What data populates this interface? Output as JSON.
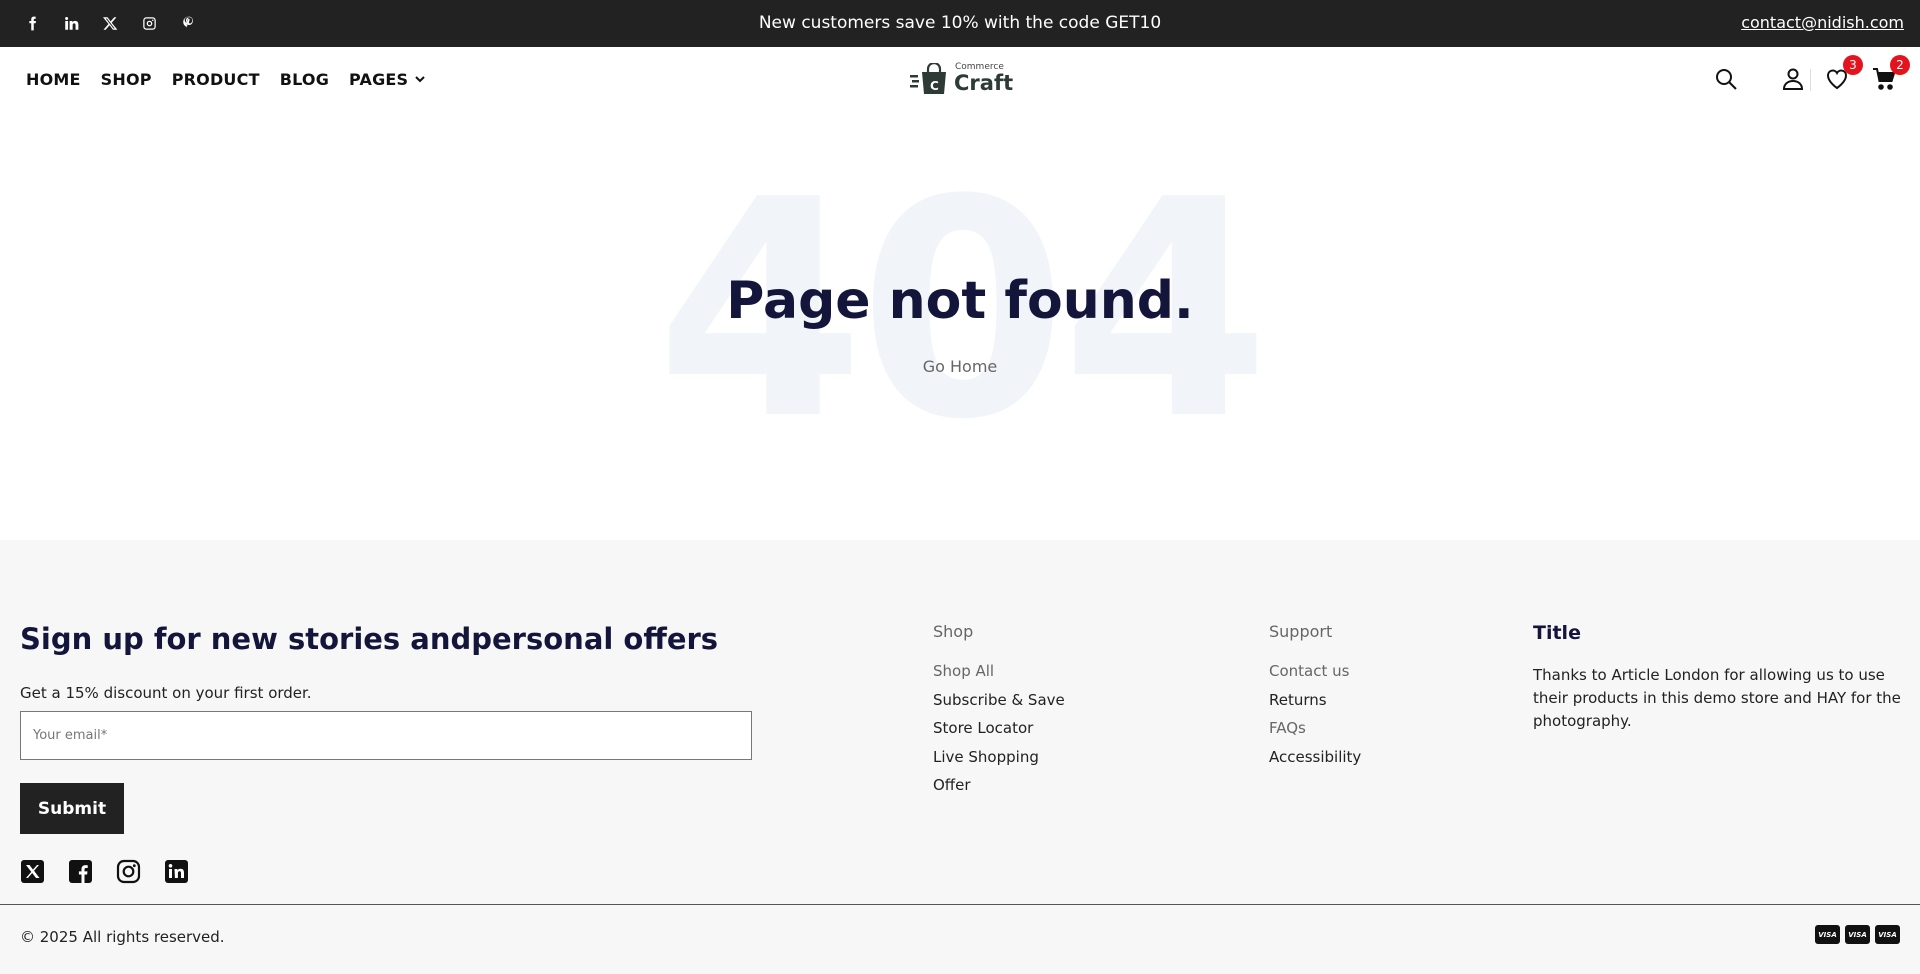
{
  "topbar": {
    "social": [
      {
        "name": "facebook-icon"
      },
      {
        "name": "linkedin-icon"
      },
      {
        "name": "x-icon"
      },
      {
        "name": "instagram-icon"
      },
      {
        "name": "pinterest-icon"
      }
    ],
    "promo": "New customers save 10% with the code GET10",
    "email": "contact@nidish.com"
  },
  "header": {
    "nav": {
      "home": "HOME",
      "shop": "SHOP",
      "product": "PRODUCT",
      "blog": "BLOG",
      "pages": "PAGES"
    },
    "logo": {
      "sub": "Commerce",
      "main": "Craft"
    },
    "wishlist_count": "3",
    "cart_count": "2"
  },
  "main": {
    "bg_text": "404",
    "title": "Page not found.",
    "link": "Go Home"
  },
  "footer": {
    "newsletter": {
      "title": "Sign up for new stories andpersonal offers",
      "desc": "Get a 15% discount on your first order.",
      "placeholder": "Your email*",
      "submit": "Submit"
    },
    "shop": {
      "heading": "Shop",
      "items": [
        "Shop All",
        "Subscribe & Save",
        "Store Locator",
        "Live Shopping",
        "Offer"
      ]
    },
    "support": {
      "heading": "Support",
      "items": [
        "Contact us",
        "Returns",
        "FAQs",
        "Accessibility"
      ]
    },
    "info": {
      "title": "Title",
      "text": "Thanks to Article London for allowing us to use their products in this demo store and HAY for the photography."
    },
    "copyright": "© 2025 All rights reserved.",
    "payments": [
      "VISA",
      "VISA",
      "VISA"
    ]
  },
  "colors": {
    "topbar_bg": "#222222",
    "heading": "#14153a",
    "badge": "#e4141e",
    "footer_bg": "#f7f7f7"
  }
}
